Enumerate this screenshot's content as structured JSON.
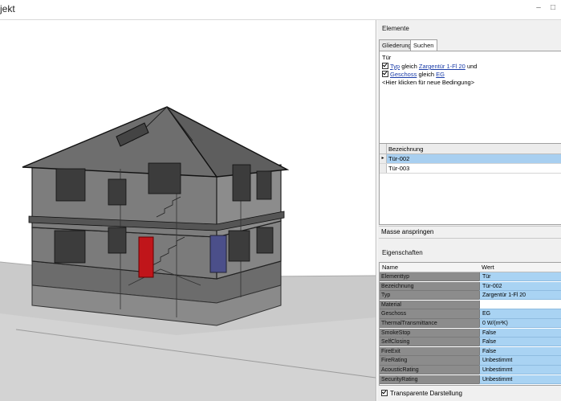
{
  "window": {
    "title": "jekt",
    "minimize_icon": "minimize-icon",
    "maximize_icon": "maximize-icon"
  },
  "elements_panel": {
    "header": "Elemente",
    "tabs": [
      "Gliederung",
      "Suchen"
    ],
    "filter": {
      "category": "Tür",
      "conditions": [
        {
          "checked": true,
          "field": "Typ",
          "op": "gleich",
          "value": "Zargentür 1-Fl 20",
          "join": "und"
        },
        {
          "checked": true,
          "field": "Geschoss",
          "op": "gleich",
          "value": "EG",
          "join": ""
        }
      ],
      "new_condition": "<Hier klicken für neue Bedingung>"
    },
    "results": {
      "column": "Bezeichnung",
      "rows": [
        "Tür-002",
        "Tür-003"
      ],
      "selected_index": 0
    },
    "jump_button": "Masse anspringen"
  },
  "properties_panel": {
    "header": "Eigenschaften",
    "columns": [
      "Name",
      "Wert"
    ],
    "rows": [
      {
        "name": "Elementtyp",
        "value": "Tür"
      },
      {
        "name": "Bezeichnung",
        "value": "Tür-002"
      },
      {
        "name": "Typ",
        "value": "Zargentür 1-Fl 20"
      },
      {
        "name": "Material",
        "value": ""
      },
      {
        "name": "Geschoss",
        "value": "EG"
      },
      {
        "name": "ThermalTransmittance",
        "value": "0 W/(m²K)"
      },
      {
        "name": "SmokeStop",
        "value": "False"
      },
      {
        "name": "SelfClosing",
        "value": "False"
      },
      {
        "name": "FireExit",
        "value": "False"
      },
      {
        "name": "FireRating",
        "value": "Unbestimmt"
      },
      {
        "name": "AcousticRating",
        "value": "Unbestimmt"
      },
      {
        "name": "SecurityRating",
        "value": "Unbestimmt"
      }
    ],
    "transparent_checkbox": {
      "checked": true,
      "label": "Transparente Darstellung"
    }
  }
}
